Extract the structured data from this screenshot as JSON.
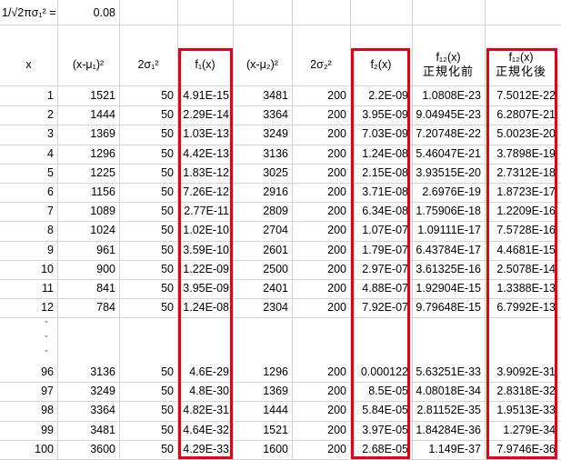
{
  "top": {
    "label": "1/√2πσ₁² =",
    "value": "0.08"
  },
  "headers": {
    "x": "x",
    "c1": "(x-μ₁)²",
    "c2": "2σ₁²",
    "c3": "f₁(x)",
    "c4": "(x-μ₂)²",
    "c5": "2σ₂²",
    "c6": "f₂(x)",
    "c7_line1": "f₁₂(x)",
    "c7_line2": "正規化前",
    "c8_line1": "f₁₂(x)",
    "c8_line2": "正規化後"
  },
  "rows_top": [
    [
      "1",
      "1521",
      "50",
      "4.91E-15",
      "3481",
      "200",
      "2.2E-09",
      "1.0808E-23",
      "7.5012E-22"
    ],
    [
      "2",
      "1444",
      "50",
      "2.29E-14",
      "3364",
      "200",
      "3.95E-09",
      "9.04945E-23",
      "6.2807E-21"
    ],
    [
      "3",
      "1369",
      "50",
      "1.03E-13",
      "3249",
      "200",
      "7.03E-09",
      "7.20748E-22",
      "5.0023E-20"
    ],
    [
      "4",
      "1296",
      "50",
      "4.42E-13",
      "3136",
      "200",
      "1.24E-08",
      "5.46047E-21",
      "3.7898E-19"
    ],
    [
      "5",
      "1225",
      "50",
      "1.83E-12",
      "3025",
      "200",
      "2.15E-08",
      "3.93515E-20",
      "2.7312E-18"
    ],
    [
      "6",
      "1156",
      "50",
      "7.26E-12",
      "2916",
      "200",
      "3.71E-08",
      "2.6976E-19",
      "1.8723E-17"
    ],
    [
      "7",
      "1089",
      "50",
      "2.77E-11",
      "2809",
      "200",
      "6.34E-08",
      "1.75906E-18",
      "1.2209E-16"
    ],
    [
      "8",
      "1024",
      "50",
      "1.02E-10",
      "2704",
      "200",
      "1.07E-07",
      "1.09111E-17",
      "7.5728E-16"
    ],
    [
      "9",
      "961",
      "50",
      "3.59E-10",
      "2601",
      "200",
      "1.79E-07",
      "6.43784E-17",
      "4.4681E-15"
    ],
    [
      "10",
      "900",
      "50",
      "1.22E-09",
      "2500",
      "200",
      "2.97E-07",
      "3.61325E-16",
      "2.5078E-14"
    ],
    [
      "11",
      "841",
      "50",
      "3.95E-09",
      "2401",
      "200",
      "4.88E-07",
      "1.92904E-15",
      "1.3388E-13"
    ],
    [
      "12",
      "784",
      "50",
      "1.24E-08",
      "2304",
      "200",
      "7.92E-07",
      "9.79648E-15",
      "6.7992E-13"
    ]
  ],
  "rows_bottom": [
    [
      "96",
      "3136",
      "50",
      "4.6E-29",
      "1296",
      "200",
      "0.000122",
      "5.63251E-33",
      "3.9092E-31"
    ],
    [
      "97",
      "3249",
      "50",
      "4.8E-30",
      "1369",
      "200",
      "8.5E-05",
      "4.08018E-34",
      "2.8318E-32"
    ],
    [
      "98",
      "3364",
      "50",
      "4.82E-31",
      "1444",
      "200",
      "5.84E-05",
      "2.81152E-35",
      "1.9513E-33"
    ],
    [
      "99",
      "3481",
      "50",
      "4.64E-32",
      "1521",
      "200",
      "3.97E-05",
      "1.84284E-36",
      "1.279E-34"
    ],
    [
      "100",
      "3600",
      "50",
      "4.29E-33",
      "1600",
      "200",
      "2.68E-05",
      "1.149E-37",
      "7.9746E-36"
    ]
  ],
  "ellipsis": "·",
  "highlight_color": "#e60012"
}
